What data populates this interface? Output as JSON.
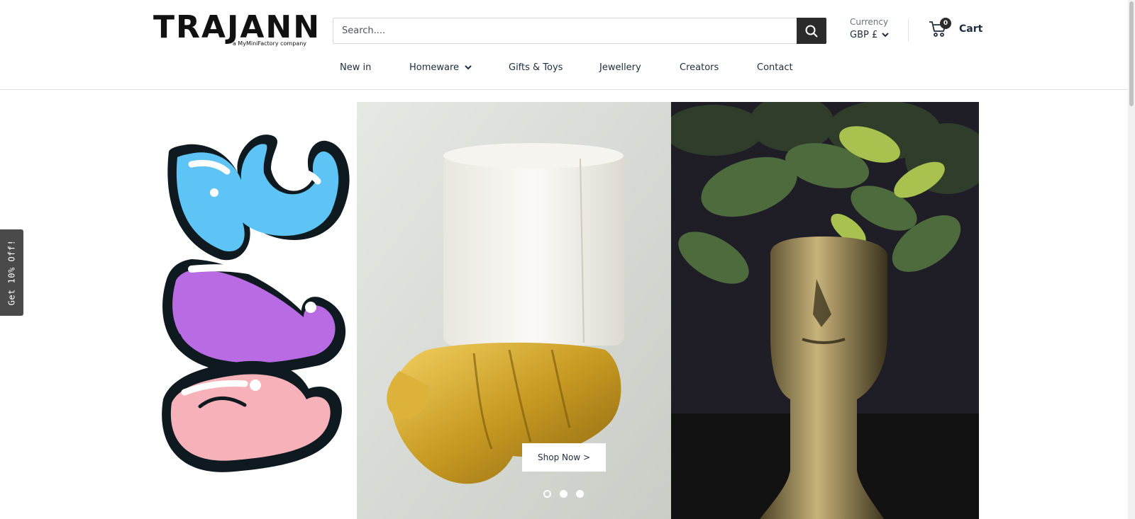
{
  "header": {
    "logo_text": "TRAJANN",
    "logo_tagline": "a MyMiniFactory company",
    "search": {
      "placeholder": "Search...."
    },
    "currency": {
      "label": "Currency",
      "value": "GBP £"
    },
    "cart": {
      "count": "0",
      "label": "Cart"
    }
  },
  "nav": {
    "items": [
      {
        "label": "New in"
      },
      {
        "label": "Homeware"
      },
      {
        "label": "Gifts & Toys"
      },
      {
        "label": "Jewellery"
      },
      {
        "label": "Creators"
      },
      {
        "label": "Contact"
      }
    ]
  },
  "side_tab": {
    "label": "Get 10% Off!"
  },
  "hero": {
    "button_label": "Shop Now >",
    "slides": 3,
    "active_slide": 1
  },
  "colors": {
    "accent": "#2b2b2b",
    "text": "#1e2d3d",
    "border": "#e1e3e4",
    "side_tab": "#4a4a4a"
  }
}
